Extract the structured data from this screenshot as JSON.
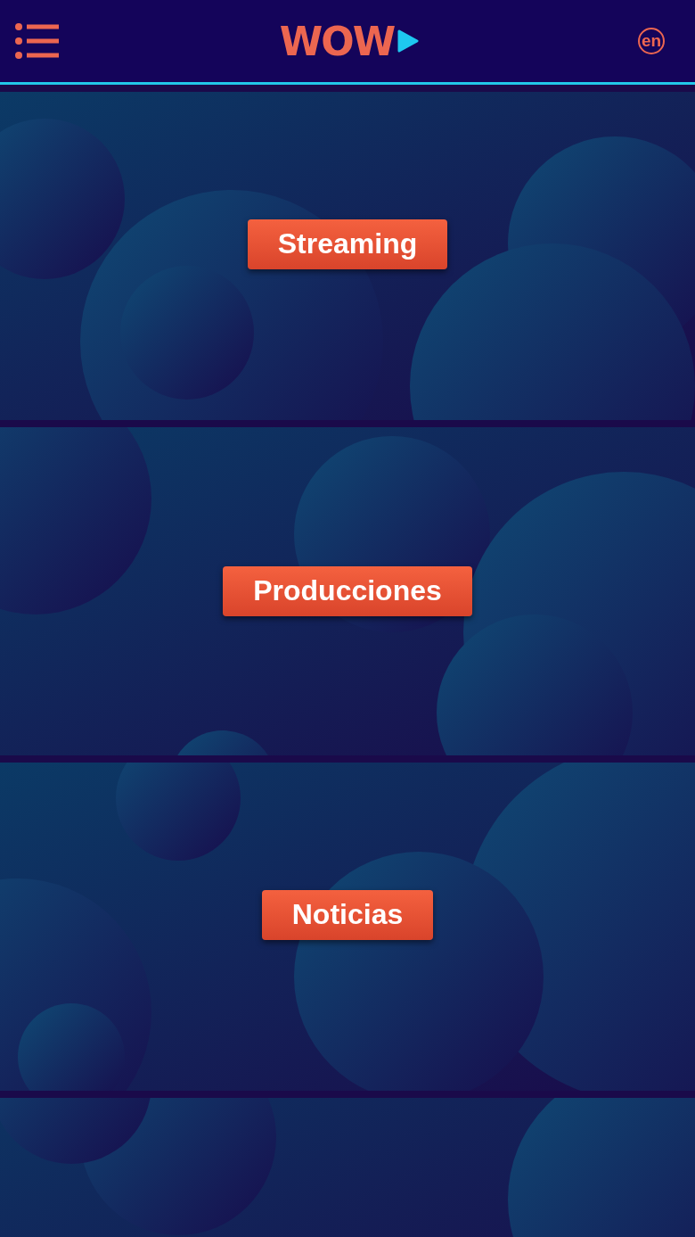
{
  "header": {
    "logo": "WOW",
    "language": "en"
  },
  "sections": [
    {
      "kind": "picture",
      "button": "Streaming"
    },
    {
      "kind": "picture",
      "button": "Producciones"
    },
    {
      "kind": "picture",
      "button": "Noticias"
    },
    {
      "kind": "picture"
    }
  ]
}
